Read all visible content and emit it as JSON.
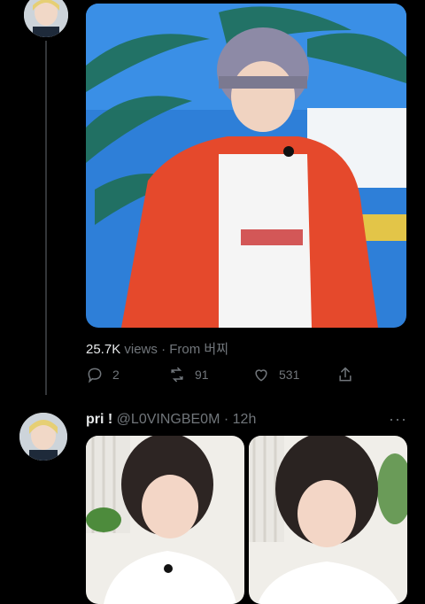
{
  "tweet1": {
    "views_count": "25.7K",
    "views_label": "views",
    "separator": "·",
    "source_text": "From 버찌",
    "replies": "2",
    "retweets": "91",
    "likes": "531",
    "icons": [
      "reply-icon",
      "retweet-icon",
      "like-icon",
      "share-icon"
    ]
  },
  "tweet2": {
    "display_name": "pri !",
    "handle": "@L0VINGBE0M",
    "separator": "·",
    "time": "12h",
    "more_label": "···"
  },
  "colors": {
    "background": "#000000",
    "text_primary": "#e7e9ea",
    "text_secondary": "#71767b",
    "thread_line": "#333639"
  }
}
